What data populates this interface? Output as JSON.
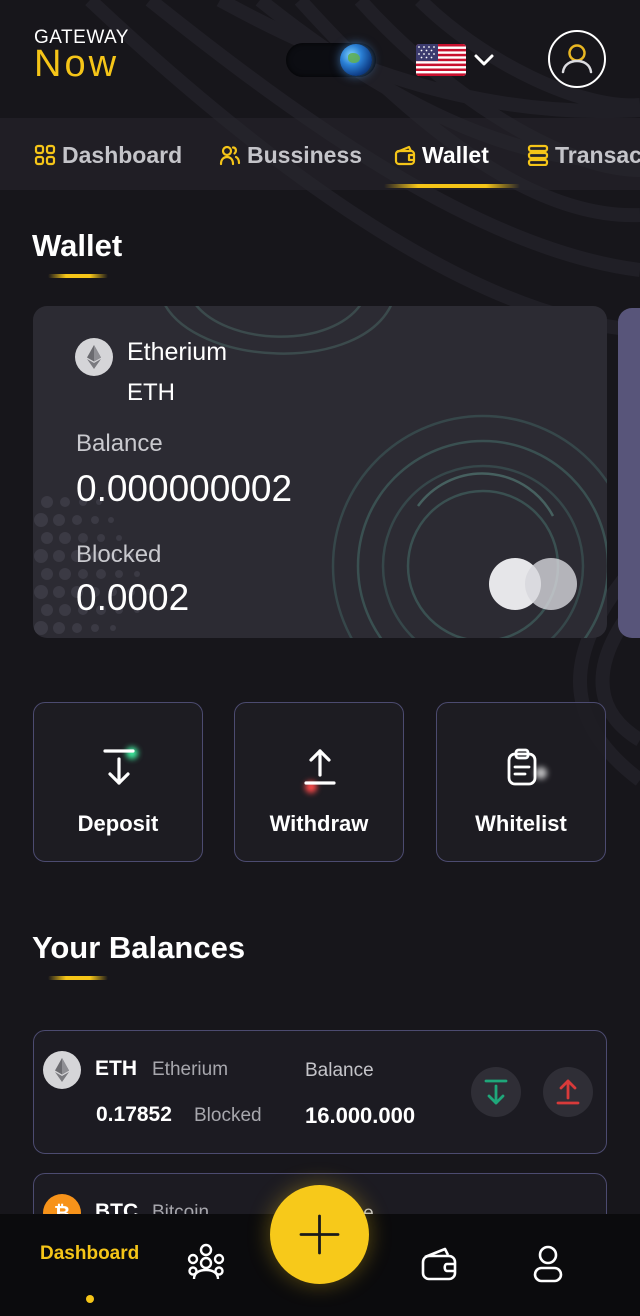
{
  "header": {
    "logo_top": "GATEWAY",
    "logo_bottom": "Now",
    "theme_icon": "globe-icon",
    "language_flag": "us-flag-icon",
    "language_chevron": "chevron-down-icon",
    "profile_icon": "user-icon"
  },
  "nav": {
    "tabs": [
      {
        "label": "Dashboard",
        "icon": "grid-icon"
      },
      {
        "label": "Bussiness",
        "icon": "users-icon"
      },
      {
        "label": "Wallet",
        "icon": "wallet-icon",
        "active": true
      },
      {
        "label": "Transac",
        "icon": "transactions-icon"
      }
    ]
  },
  "wallet": {
    "title": "Wallet",
    "card": {
      "coin_name": "Etherium",
      "coin_symbol": "ETH",
      "balance_label": "Balance",
      "balance_value": "0.000000002",
      "blocked_label": "Blocked",
      "blocked_value": "0.0002"
    }
  },
  "actions": [
    {
      "label": "Deposit",
      "icon": "deposit-arrow-icon"
    },
    {
      "label": "Withdraw",
      "icon": "withdraw-arrow-icon"
    },
    {
      "label": "Whitelist",
      "icon": "clipboard-icon"
    }
  ],
  "balances": {
    "title": "Your Balances",
    "rows": [
      {
        "symbol": "ETH",
        "name": "Etherium",
        "amount": "0.17852",
        "blocked_label": "Blocked",
        "balance_label": "Balance",
        "balance": "16.000.000"
      },
      {
        "symbol": "BTC",
        "name": "Bitcoin",
        "amount": "",
        "blocked_label": "",
        "balance_label": "Balance",
        "balance": ""
      }
    ]
  },
  "bottom_nav": {
    "active_label": "Dashboard",
    "items": [
      "dashboard",
      "group-icon",
      "add-button",
      "wallet-icon",
      "profile-icon"
    ]
  },
  "colors": {
    "accent": "#f5c518",
    "background": "#17161b",
    "card": "#2c2b33",
    "deposit": "#1fa77a",
    "withdraw": "#d83a3a",
    "border": "#4c4b70"
  }
}
